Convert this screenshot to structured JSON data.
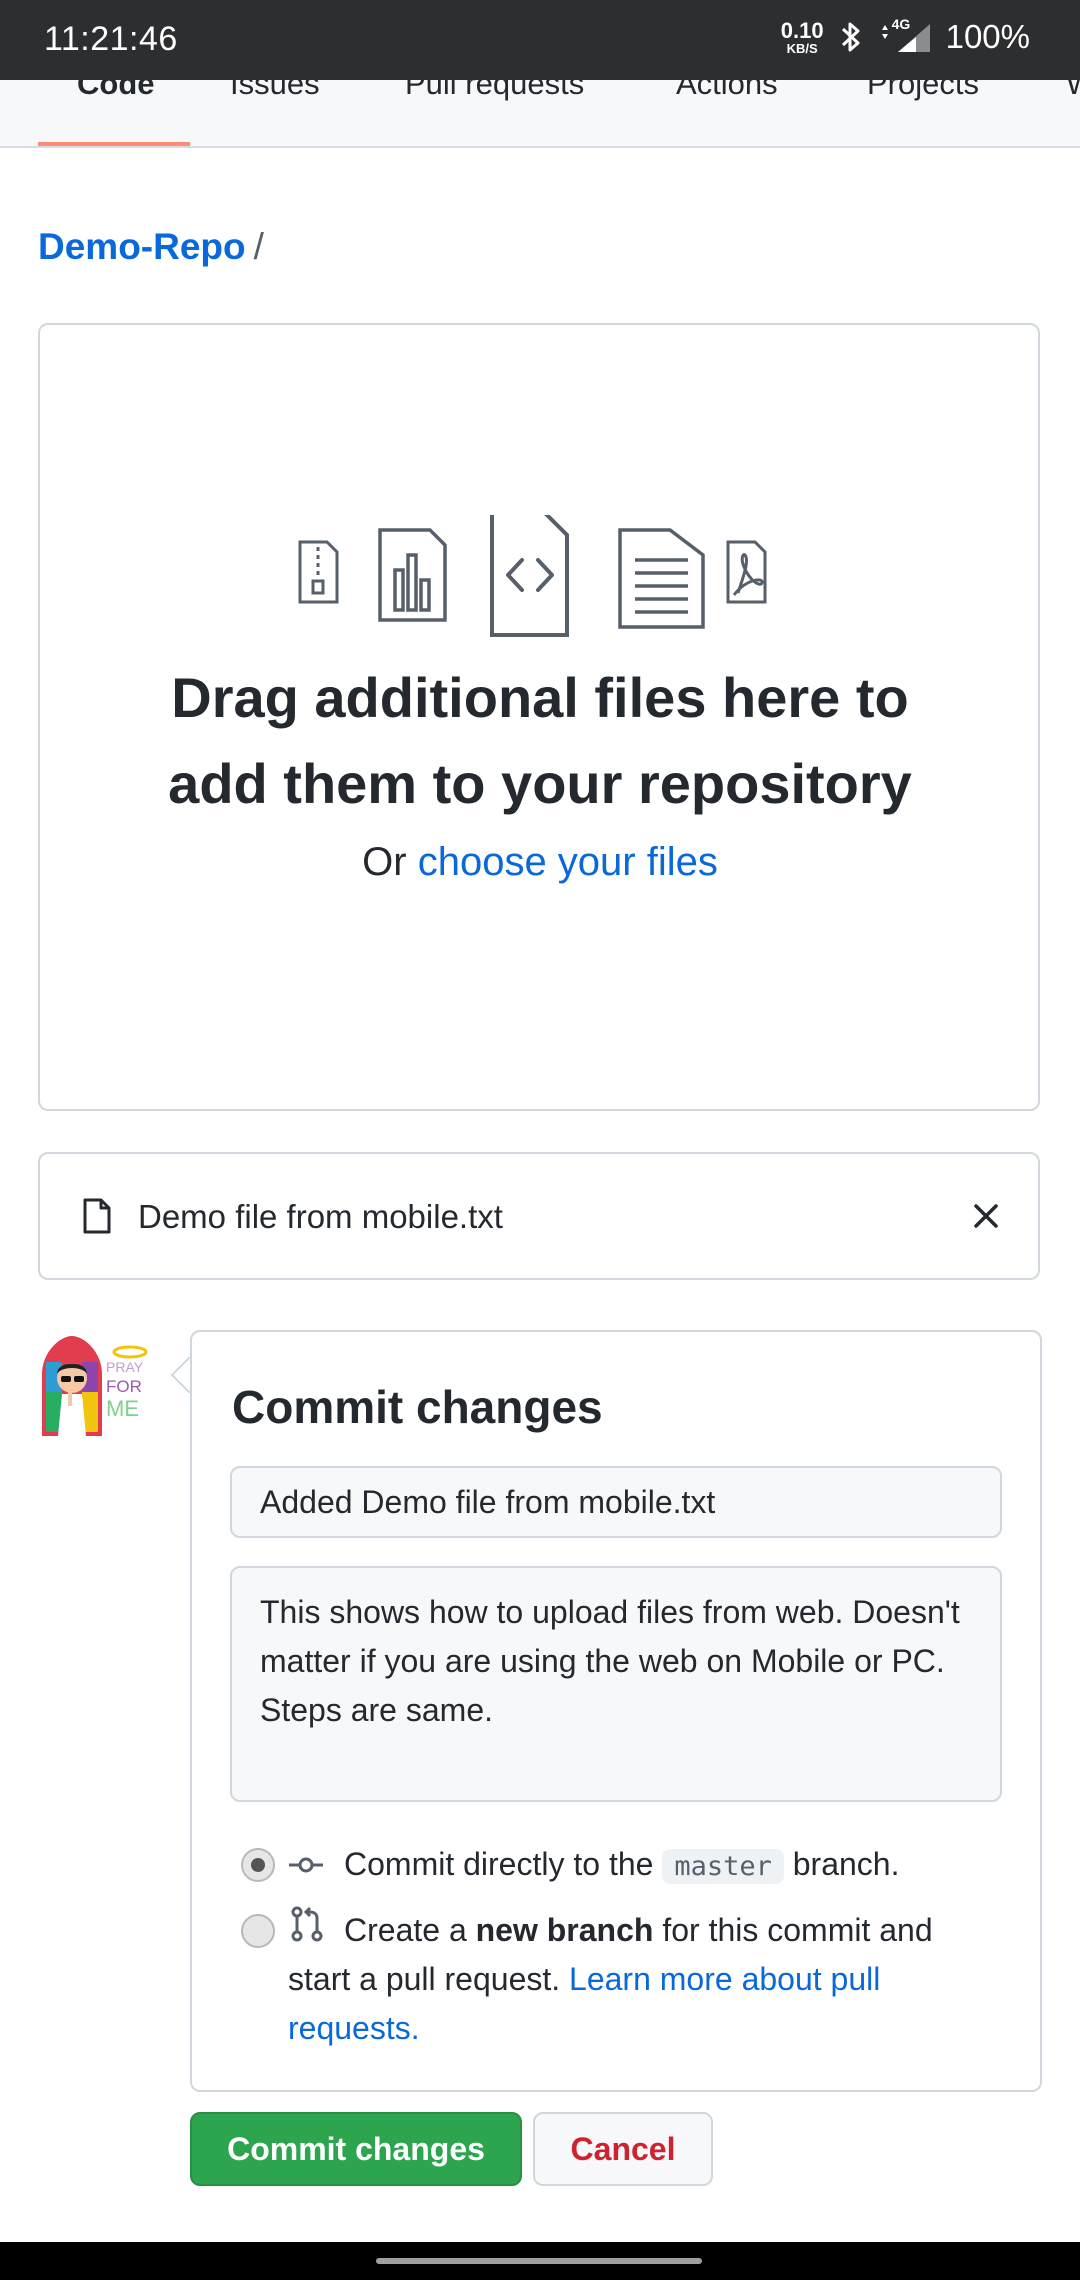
{
  "status_bar": {
    "time": "11:21:46",
    "net_speed_value": "0.10",
    "net_speed_unit": "KB/S",
    "network": "4G",
    "battery": "100%"
  },
  "tabs": [
    {
      "label": "Code",
      "active": true
    },
    {
      "label": "Issues"
    },
    {
      "label": "Pull requests"
    },
    {
      "label": "Actions"
    },
    {
      "label": "Projects"
    },
    {
      "label": "W"
    }
  ],
  "breadcrumb": {
    "repo": "Demo-Repo",
    "separator": "/"
  },
  "dropzone": {
    "title_line1": "Drag additional files here to",
    "title_line2": "add them to your repository",
    "sub_prefix": "Or",
    "sub_link": "choose your files"
  },
  "uploaded_file": {
    "name": "Demo file from mobile.txt"
  },
  "avatar": {
    "line1": "PRAY",
    "line2": "FOR",
    "line3": "ME"
  },
  "commit": {
    "title": "Commit changes",
    "summary_value": "Added Demo file from mobile.txt",
    "description_value": "This shows how to upload files from web. Doesn't matter if you are using the web on Mobile or PC. Steps are same.",
    "option_direct": {
      "prefix": "Commit directly to the",
      "branch": "master",
      "suffix": "branch.",
      "selected": true
    },
    "option_new_branch": {
      "prefix": "Create a",
      "bold": "new branch",
      "suffix": "for this commit and",
      "line2": "start a pull request.",
      "link_part1": "Learn more about pull",
      "link_part2": "requests.",
      "selected": false
    }
  },
  "buttons": {
    "commit": "Commit changes",
    "cancel": "Cancel"
  },
  "colors": {
    "link": "#0969da",
    "commit_button": "#2da44e",
    "cancel_text": "#cf222e",
    "tab_underline": "#fd8c73"
  }
}
